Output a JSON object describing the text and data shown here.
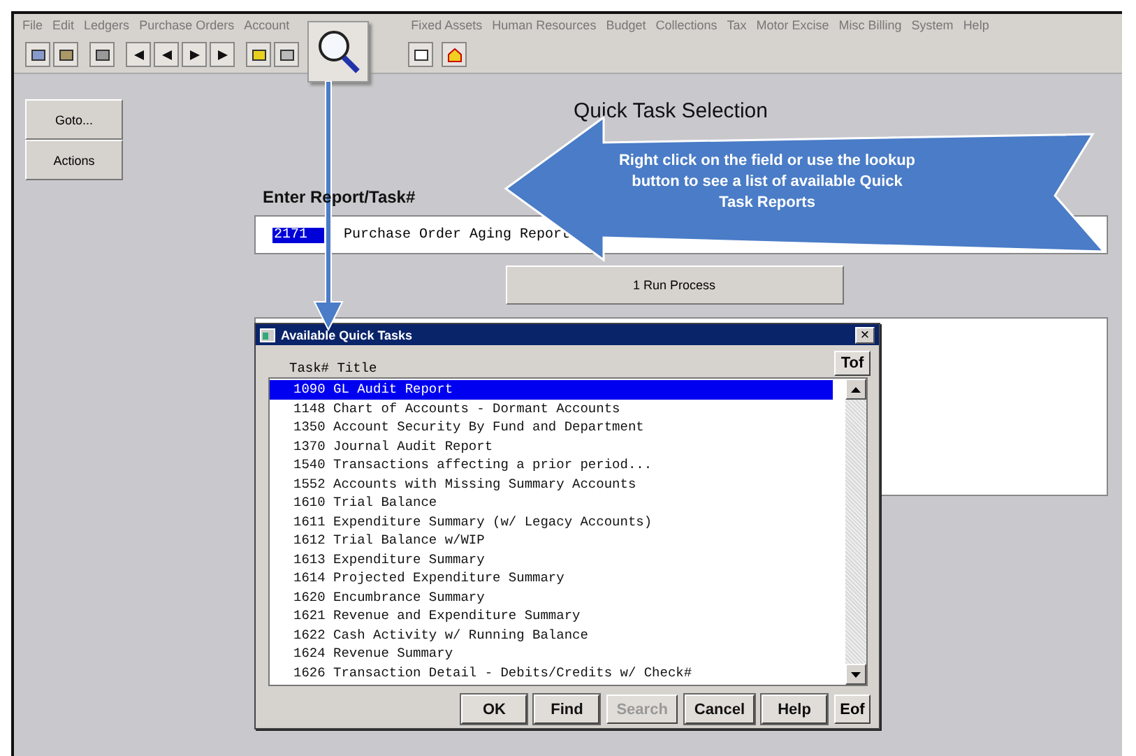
{
  "menu": [
    "File",
    "Edit",
    "Ledgers",
    "Purchase Orders",
    "Account",
    "Fixed Assets",
    "Human Resources",
    "Budget",
    "Collections",
    "Tax",
    "Motor Excise",
    "Misc Billing",
    "System",
    "Help"
  ],
  "side_buttons": [
    "Goto...",
    "Actions"
  ],
  "title": "Quick Task Selection",
  "field_label": "Enter Report/Task#",
  "task_field": {
    "value": "2171",
    "description": "Purchase Order Aging Report"
  },
  "run_button": "1 Run Process",
  "callout": "Right click on the field or use the lookup button to see a list of available Quick Task Reports",
  "dialog": {
    "title": "Available Quick Tasks",
    "close": "×",
    "columns_label": "Task# Title",
    "top_button": "Tof",
    "bottom_button": "Eof",
    "rows": [
      {
        "text": "1090 GL Audit Report",
        "selected": true
      },
      {
        "text": "1148 Chart of Accounts - Dormant Accounts",
        "selected": false
      },
      {
        "text": "1350 Account Security By Fund and Department",
        "selected": false
      },
      {
        "text": "1370 Journal Audit Report",
        "selected": false
      },
      {
        "text": "1540 Transactions affecting a prior period...",
        "selected": false
      },
      {
        "text": "1552 Accounts with Missing Summary Accounts",
        "selected": false
      },
      {
        "text": "1610 Trial Balance",
        "selected": false
      },
      {
        "text": "1611 Expenditure Summary (w/ Legacy Accounts)",
        "selected": false
      },
      {
        "text": "1612 Trial Balance w/WIP",
        "selected": false
      },
      {
        "text": "1613 Expenditure Summary",
        "selected": false
      },
      {
        "text": "1614 Projected Expenditure Summary",
        "selected": false
      },
      {
        "text": "1620 Encumbrance Summary",
        "selected": false
      },
      {
        "text": "1621 Revenue and Expenditure Summary",
        "selected": false
      },
      {
        "text": "1622 Cash Activity w/ Running Balance",
        "selected": false
      },
      {
        "text": "1624 Revenue Summary",
        "selected": false
      },
      {
        "text": "1626 Transaction Detail - Debits/Credits w/ Check#",
        "selected": false
      }
    ],
    "buttons": [
      {
        "label": "OK",
        "disabled": false
      },
      {
        "label": "Find",
        "disabled": false
      },
      {
        "label": "Search",
        "disabled": true
      },
      {
        "label": "Cancel",
        "disabled": false
      },
      {
        "label": "Help",
        "disabled": false
      }
    ]
  }
}
